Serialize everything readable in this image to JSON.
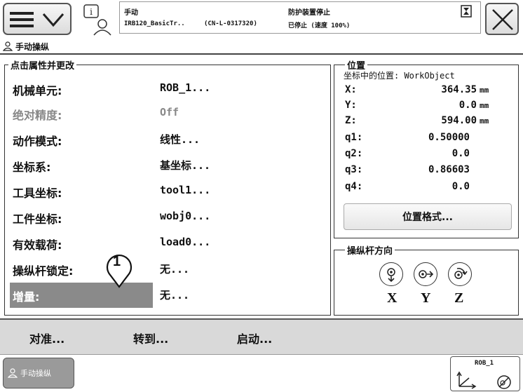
{
  "header": {
    "mode": "手动",
    "controller": "IRB120_BasicTr..",
    "serial": "(CN-L-0317320)",
    "safety": "防护装置停止",
    "state": "已停止 (速度 100%)"
  },
  "app": {
    "title": "手动操纵"
  },
  "properties": {
    "legend": "点击属性并更改",
    "rows": [
      {
        "label": "机械单元:",
        "value": "ROB_1..."
      },
      {
        "label": "绝对精度:",
        "value": "Off"
      },
      {
        "label": "动作模式:",
        "value": "线性..."
      },
      {
        "label": "坐标系:",
        "value": "基坐标..."
      },
      {
        "label": "工具坐标:",
        "value": "tool1..."
      },
      {
        "label": "工件坐标:",
        "value": "wobj0..."
      },
      {
        "label": "有效载荷:",
        "value": "load0..."
      },
      {
        "label": "操纵杆锁定:",
        "value": "无..."
      },
      {
        "label": "增量:",
        "value": "无..."
      }
    ]
  },
  "annotation": {
    "marker": "1"
  },
  "position": {
    "legend": "位置",
    "subtitle": "坐标中的位置: WorkObject",
    "rows": [
      {
        "label": "X:",
        "value": "364.35",
        "unit": "mm"
      },
      {
        "label": "Y:",
        "value": "0.0",
        "unit": "mm"
      },
      {
        "label": "Z:",
        "value": "594.00",
        "unit": "mm"
      },
      {
        "label": "q1:",
        "value": "0.50000",
        "unit": ""
      },
      {
        "label": "q2:",
        "value": "0.0",
        "unit": ""
      },
      {
        "label": "q3:",
        "value": "0.86603",
        "unit": ""
      },
      {
        "label": "q4:",
        "value": "0.0",
        "unit": ""
      }
    ],
    "format_button": "位置格式..."
  },
  "joystick": {
    "legend": "操纵杆方向",
    "axes": [
      "X",
      "Y",
      "Z"
    ]
  },
  "commands": {
    "align": "对准...",
    "goto": "转到...",
    "activate": "启动..."
  },
  "taskbar": {
    "item": "手动操纵",
    "quickset_label": "ROB_1"
  }
}
